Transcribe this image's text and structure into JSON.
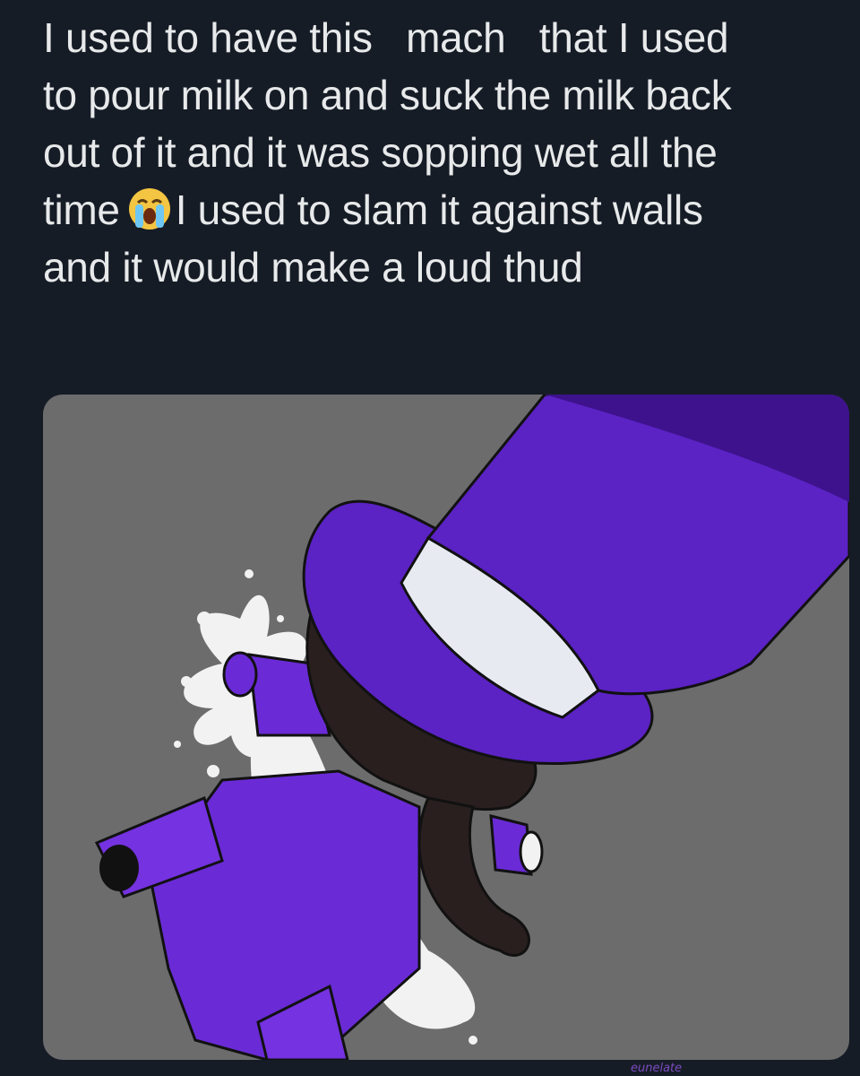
{
  "tweet": {
    "lines": [
      "I used to have this   mach   that I used",
      "to pour milk on and suck the milk back",
      "out of it and it was sopping wet all the",
      "I used to slam it against walls",
      "and it would make a loud thud"
    ],
    "line4_prefix": "time",
    "emoji": "loudly-crying-face"
  },
  "media": {
    "description_icon": "purple-top-hat-character-artwork",
    "signature": "eunelate",
    "colors": {
      "background": "#6c6c6c",
      "hat": "#5b22c4",
      "hat_dark": "#3d128c",
      "band": "#e8eaf2",
      "hair": "#2a1f1f",
      "suit": "#6a2bd6",
      "splash": "#f2f2f2"
    }
  }
}
